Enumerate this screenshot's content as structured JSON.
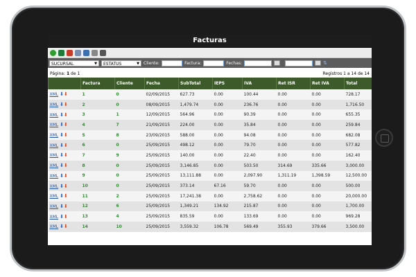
{
  "window": {
    "title": "Facturas"
  },
  "toolbar": {
    "icons": [
      "add-icon",
      "excel-icon",
      "pdf-icon",
      "settings-icon",
      "view-icon",
      "list-icon",
      "print-icon"
    ]
  },
  "filters": {
    "sucursal": "SUCURSAL",
    "estatus": "ESTATUS",
    "cliente_label": "Cliente:",
    "factura_label": "Factura:",
    "fechas_label": "Fechas:"
  },
  "pager": {
    "pagina_prefix": "Página:",
    "page": "1",
    "pagina_suffix": "de 1",
    "registros": "Registros 1 a 14 de 14"
  },
  "table": {
    "headers": [
      "",
      "Factura",
      "Cliente",
      "Fecha",
      "SubTotal",
      "IEPS",
      "IVA",
      "Ret ISR",
      "Ret IVA",
      "Total"
    ],
    "xml_label": "XML",
    "rows": [
      {
        "factura": "1",
        "cliente": "0",
        "fecha": "02/09/2015",
        "subtotal": "627.73",
        "ieps": "0.00",
        "iva": "100.44",
        "ret_isr": "0.00",
        "ret_iva": "0.00",
        "total": "728.17"
      },
      {
        "factura": "2",
        "cliente": "0",
        "fecha": "08/09/2015",
        "subtotal": "1,479.74",
        "ieps": "0.00",
        "iva": "236.76",
        "ret_isr": "0.00",
        "ret_iva": "0.00",
        "total": "1,716.50"
      },
      {
        "factura": "3",
        "cliente": "1",
        "fecha": "12/09/2015",
        "subtotal": "564.96",
        "ieps": "0.00",
        "iva": "90.39",
        "ret_isr": "0.00",
        "ret_iva": "0.00",
        "total": "655.35"
      },
      {
        "factura": "4",
        "cliente": "7",
        "fecha": "21/09/2015",
        "subtotal": "224.00",
        "ieps": "0.00",
        "iva": "35.84",
        "ret_isr": "0.00",
        "ret_iva": "0.00",
        "total": "259.84"
      },
      {
        "factura": "5",
        "cliente": "8",
        "fecha": "23/09/2015",
        "subtotal": "588.00",
        "ieps": "0.00",
        "iva": "94.08",
        "ret_isr": "0.00",
        "ret_iva": "0.00",
        "total": "682.08"
      },
      {
        "factura": "6",
        "cliente": "0",
        "fecha": "25/09/2015",
        "subtotal": "498.12",
        "ieps": "0.00",
        "iva": "79.70",
        "ret_isr": "0.00",
        "ret_iva": "0.00",
        "total": "577.82"
      },
      {
        "factura": "7",
        "cliente": "9",
        "fecha": "25/09/2015",
        "subtotal": "140.00",
        "ieps": "0.00",
        "iva": "22.40",
        "ret_isr": "0.00",
        "ret_iva": "0.00",
        "total": "162.40"
      },
      {
        "factura": "8",
        "cliente": "0",
        "fecha": "25/09/2015",
        "subtotal": "3,146.85",
        "ieps": "0.00",
        "iva": "503.50",
        "ret_isr": "314.69",
        "ret_iva": "335.66",
        "total": "3,000.00"
      },
      {
        "factura": "9",
        "cliente": "0",
        "fecha": "25/09/2015",
        "subtotal": "13,111.88",
        "ieps": "0.00",
        "iva": "2,097.90",
        "ret_isr": "1,311.19",
        "ret_iva": "1,398.59",
        "total": "12,500.00"
      },
      {
        "factura": "10",
        "cliente": "0",
        "fecha": "25/09/2015",
        "subtotal": "373.14",
        "ieps": "67.16",
        "iva": "59.70",
        "ret_isr": "0.00",
        "ret_iva": "0.00",
        "total": "500.00"
      },
      {
        "factura": "11",
        "cliente": "2",
        "fecha": "25/09/2015",
        "subtotal": "17,241.38",
        "ieps": "0.00",
        "iva": "2,758.62",
        "ret_isr": "0.00",
        "ret_iva": "0.00",
        "total": "20,000.00"
      },
      {
        "factura": "12",
        "cliente": "6",
        "fecha": "25/09/2015",
        "subtotal": "1,349.21",
        "ieps": "134.92",
        "iva": "215.87",
        "ret_isr": "0.00",
        "ret_iva": "0.00",
        "total": "1,700.00"
      },
      {
        "factura": "13",
        "cliente": "4",
        "fecha": "25/09/2015",
        "subtotal": "835.59",
        "ieps": "0.00",
        "iva": "133.69",
        "ret_isr": "0.00",
        "ret_iva": "0.00",
        "total": "969.28"
      },
      {
        "factura": "14",
        "cliente": "10",
        "fecha": "25/09/2015",
        "subtotal": "3,559.32",
        "ieps": "106.78",
        "iva": "569.49",
        "ret_isr": "355.93",
        "ret_iva": "379.66",
        "total": "3,500.00"
      }
    ]
  },
  "colors": {
    "header_green": "#3d5a2b",
    "accent_green": "#2e8b2e",
    "filter_bar": "#5c5c5c"
  }
}
